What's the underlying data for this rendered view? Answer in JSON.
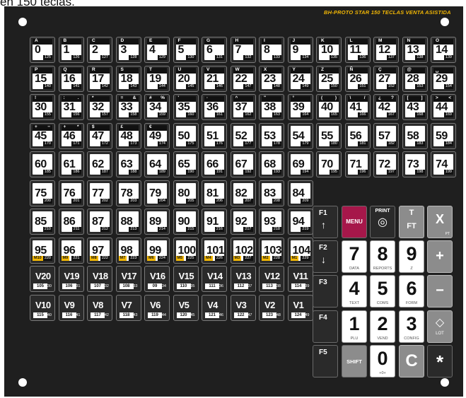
{
  "caption": "en 150 teclas.",
  "title": "BH-PROTO STAR 150 TECLAS VENTA ASISTIDA",
  "rows": [
    [
      {
        "n": "0",
        "code": "125",
        "ll": "A"
      },
      {
        "n": "1",
        "code": "126",
        "ll": "B"
      },
      {
        "n": "2",
        "code": "127",
        "ll": "C"
      },
      {
        "n": "3",
        "code": "128",
        "ll": "D"
      },
      {
        "n": "4",
        "code": "129",
        "ll": "E"
      },
      {
        "n": "5",
        "code": "130",
        "ll": "F"
      },
      {
        "n": "6",
        "code": "131",
        "ll": "G"
      },
      {
        "n": "7",
        "code": "132",
        "ll": "H"
      },
      {
        "n": "8",
        "code": "133",
        "ll": "I"
      },
      {
        "n": "9",
        "code": "134",
        "ll": "J"
      },
      {
        "n": "10",
        "code": "135",
        "ll": "K"
      },
      {
        "n": "11",
        "code": "136",
        "ll": "L"
      },
      {
        "n": "12",
        "code": "137",
        "ll": "M"
      },
      {
        "n": "13",
        "code": "138",
        "ll": "N"
      },
      {
        "n": "14",
        "code": "139",
        "ll": "O"
      }
    ],
    [
      {
        "n": "15",
        "code": "140",
        "ll": "P"
      },
      {
        "n": "16",
        "code": "141",
        "ll": "Q"
      },
      {
        "n": "17",
        "code": "142",
        "ll": "R"
      },
      {
        "n": "18",
        "code": "143",
        "ll": "S"
      },
      {
        "n": "19",
        "code": "144",
        "ll": "T"
      },
      {
        "n": "20",
        "code": "145",
        "ll": "U"
      },
      {
        "n": "21",
        "code": "146",
        "ll": "V"
      },
      {
        "n": "22",
        "code": "147",
        "ll": "W"
      },
      {
        "n": "23",
        "code": "148",
        "ll": "X"
      },
      {
        "n": "24",
        "code": "149",
        "ll": "Y"
      },
      {
        "n": "25",
        "code": "150",
        "ll": "Z"
      },
      {
        "n": "26",
        "code": "151",
        "ll": "Ñ"
      },
      {
        "n": "27",
        "code": "152",
        "ll": "Ç"
      },
      {
        "n": "28",
        "code": "153",
        "ll": "@"
      },
      {
        "n": "29",
        "code": "154",
        "ll": "␣"
      }
    ],
    [
      {
        "n": "30",
        "code": "155",
        "ll": "!",
        "lr": ""
      },
      {
        "n": "31",
        "code": "156",
        "ll": ":",
        "lr": "."
      },
      {
        "n": "32",
        "code": "157",
        "ll": "*"
      },
      {
        "n": "33",
        "code": "158",
        "ll": "=",
        "lr": "&"
      },
      {
        "n": "34",
        "code": "159",
        "ll": "#",
        "lr": "%"
      },
      {
        "n": "35",
        "code": "160",
        "ll": "'"
      },
      {
        "n": "36",
        "code": "161",
        "ll": "·"
      },
      {
        "n": "37",
        "code": "162",
        "ll": "^"
      },
      {
        "n": "38",
        "code": "163",
        "ll": "\""
      },
      {
        "n": "39",
        "code": "164",
        "ll": "°"
      },
      {
        "n": "40",
        "code": "165",
        "ll": "(",
        "lr": ")"
      },
      {
        "n": "41",
        "code": "166",
        "ll": "\\",
        "lr": "/"
      },
      {
        "n": "42",
        "code": "167",
        "ll": "¿",
        "lr": "?"
      },
      {
        "n": "43",
        "code": "168",
        "ll": "[",
        "lr": "]"
      },
      {
        "n": "44",
        "code": "169",
        "ll": ">",
        "lr": "<"
      }
    ],
    [
      {
        "n": "45",
        "code": "170",
        "ll": "+",
        "lr": "−"
      },
      {
        "n": "46",
        "code": "171",
        "ll": "+",
        "lr": "*"
      },
      {
        "n": "47",
        "code": "172",
        "ll": "$"
      },
      {
        "n": "48",
        "code": "173",
        "ll": "£"
      },
      {
        "n": "49",
        "code": "174",
        "ll": "€"
      },
      {
        "n": "50",
        "code": "175"
      },
      {
        "n": "51",
        "code": "176"
      },
      {
        "n": "52",
        "code": "177"
      },
      {
        "n": "53",
        "code": "178"
      },
      {
        "n": "54",
        "code": "179"
      },
      {
        "n": "55",
        "code": "180"
      },
      {
        "n": "56",
        "code": "181"
      },
      {
        "n": "57",
        "code": "182"
      },
      {
        "n": "58",
        "code": "183"
      },
      {
        "n": "59",
        "code": "184"
      }
    ],
    [
      {
        "n": "60",
        "code": "185"
      },
      {
        "n": "61",
        "code": "186"
      },
      {
        "n": "62",
        "code": "187"
      },
      {
        "n": "63",
        "code": "188"
      },
      {
        "n": "64",
        "code": "189"
      },
      {
        "n": "65",
        "code": "190"
      },
      {
        "n": "66",
        "code": "191"
      },
      {
        "n": "67",
        "code": "192"
      },
      {
        "n": "68",
        "code": "193"
      },
      {
        "n": "69",
        "code": "194"
      },
      {
        "n": "70",
        "code": "195"
      },
      {
        "n": "71",
        "code": "196"
      },
      {
        "n": "72",
        "code": "197"
      },
      {
        "n": "73",
        "code": "198"
      },
      {
        "n": "74",
        "code": "199"
      }
    ],
    [
      {
        "n": "75",
        "code": "200"
      },
      {
        "n": "76",
        "code": "201"
      },
      {
        "n": "77",
        "code": "202"
      },
      {
        "n": "78",
        "code": "203"
      },
      {
        "n": "79",
        "code": "204"
      },
      {
        "n": "80",
        "code": "205"
      },
      {
        "n": "81",
        "code": "206"
      },
      {
        "n": "82",
        "code": "207"
      },
      {
        "n": "83",
        "code": "208"
      },
      {
        "n": "84",
        "code": "209"
      }
    ],
    [
      {
        "n": "85",
        "code": "210"
      },
      {
        "n": "86",
        "code": "211"
      },
      {
        "n": "87",
        "code": "212"
      },
      {
        "n": "88",
        "code": "213"
      },
      {
        "n": "89",
        "code": "214"
      },
      {
        "n": "90",
        "code": "215"
      },
      {
        "n": "91",
        "code": "216"
      },
      {
        "n": "92",
        "code": "217"
      },
      {
        "n": "93",
        "code": "218"
      },
      {
        "n": "94",
        "code": "219"
      }
    ],
    [
      {
        "n": "95",
        "code": "220",
        "m": "M10"
      },
      {
        "n": "96",
        "code": "221",
        "m": "M9"
      },
      {
        "n": "97",
        "code": "222",
        "m": "M8"
      },
      {
        "n": "98",
        "code": "223",
        "m": "M7"
      },
      {
        "n": "99",
        "code": "224",
        "m": "M6"
      },
      {
        "n": "100",
        "code": "225",
        "m": "M5"
      },
      {
        "n": "101",
        "code": "226",
        "m": "M4"
      },
      {
        "n": "102",
        "code": "227",
        "m": "M3"
      },
      {
        "n": "103",
        "code": "228",
        "m": "M2"
      },
      {
        "n": "104",
        "code": "229",
        "m": "M1"
      }
    ],
    [
      {
        "n": "V20",
        "code": "230",
        "s": "105"
      },
      {
        "n": "V19",
        "code": "231",
        "s": "106"
      },
      {
        "n": "V18",
        "code": "232",
        "s": "107"
      },
      {
        "n": "V17",
        "code": "233",
        "s": "108"
      },
      {
        "n": "V16",
        "code": "234",
        "s": "09"
      },
      {
        "n": "V15",
        "code": "235",
        "s": "110"
      },
      {
        "n": "V14",
        "code": "236",
        "s": "111"
      },
      {
        "n": "V13",
        "code": "237",
        "s": "112"
      },
      {
        "n": "V12",
        "code": "238",
        "s": "113"
      },
      {
        "n": "V11",
        "code": "239",
        "s": "114"
      }
    ],
    [
      {
        "n": "V10",
        "code": "240",
        "s": "115"
      },
      {
        "n": "V9",
        "code": "241",
        "s": "116"
      },
      {
        "n": "V8",
        "code": "242",
        "s": "117"
      },
      {
        "n": "V7",
        "code": "243",
        "s": "118"
      },
      {
        "n": "V6",
        "code": "244",
        "s": "119"
      },
      {
        "n": "V5",
        "code": "245",
        "s": "120"
      },
      {
        "n": "V4",
        "code": "246",
        "s": "121"
      },
      {
        "n": "V3",
        "code": "247",
        "s": "122"
      },
      {
        "n": "V2",
        "code": "248",
        "s": "123"
      },
      {
        "n": "V1",
        "code": "249",
        "s": "124"
      }
    ]
  ],
  "fkeys": [
    {
      "label": "F1",
      "arrow": "↑"
    },
    {
      "label": "F2",
      "arrow": "↓"
    },
    {
      "label": "F3",
      "arrow": ""
    },
    {
      "label": "F4",
      "arrow": ""
    },
    {
      "label": "F5",
      "arrow": ""
    }
  ],
  "menu": "MENU",
  "print": "PRINT",
  "tft_top": "T",
  "tft_bottom": "FT",
  "x_label": "X",
  "x_sub": "PT",
  "numpad": [
    [
      {
        "big": "7",
        "sub": "DATA"
      },
      {
        "big": "8",
        "sub": "REPORTS"
      },
      {
        "big": "9",
        "sub": "Z"
      }
    ],
    [
      {
        "big": "4",
        "sub": "TEXT"
      },
      {
        "big": "5",
        "sub": "COMS"
      },
      {
        "big": "6",
        "sub": "FORM"
      }
    ],
    [
      {
        "big": "1",
        "sub": "PLU"
      },
      {
        "big": "2",
        "sub": "VEND"
      },
      {
        "big": "3",
        "sub": "CONFIG"
      }
    ]
  ],
  "plus": "+",
  "minus": "−",
  "lot": "LOT",
  "shift": "SHIFT",
  "zero": "0",
  "zero_sub": "+0+",
  "clear": "C",
  "star": "*",
  "colors": {
    "panel": "#1f1f1f",
    "accent": "#f2b705",
    "menu": "#a6174a",
    "gray_key": "#8c8c8c"
  }
}
